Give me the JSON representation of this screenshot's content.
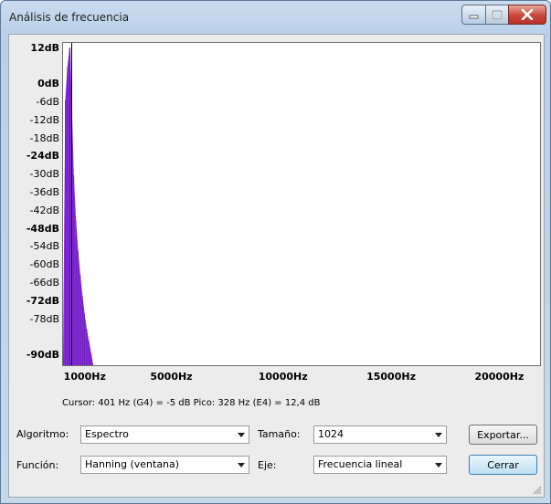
{
  "window": {
    "title": "Análisis de frecuencia"
  },
  "title_buttons": {
    "minimize": "minimize-icon",
    "maximize": "maximize-icon",
    "close": "close-icon"
  },
  "graph": {
    "y_ticks": [
      "12dB",
      "0dB",
      "-6dB",
      "-12dB",
      "-18dB",
      "-24dB",
      "-30dB",
      "-36dB",
      "-42dB",
      "-48dB",
      "-54dB",
      "-60dB",
      "-66dB",
      "-72dB",
      "-78dB",
      "-90dB"
    ],
    "x_ticks": [
      "1000Hz",
      "5000Hz",
      "10000Hz",
      "15000Hz",
      "20000Hz"
    ],
    "fill_color": "#8a2be2"
  },
  "chart_data": {
    "type": "area",
    "xlabel": "",
    "ylabel": "",
    "xlim": [
      0,
      22050
    ],
    "ylim": [
      -93,
      14
    ],
    "x_ticks": [
      1000,
      5000,
      10000,
      15000,
      20000
    ],
    "y_ticks": [
      12,
      0,
      -6,
      -12,
      -18,
      -24,
      -30,
      -36,
      -42,
      -48,
      -54,
      -60,
      -66,
      -72,
      -78,
      -90
    ],
    "x": [
      0,
      100,
      200,
      300,
      328,
      401,
      500,
      600,
      700,
      800,
      900,
      1000,
      1100,
      1200,
      1300,
      1400
    ],
    "values": [
      -90,
      -5,
      6,
      12.4,
      12.4,
      -5,
      -30,
      -45,
      -55,
      -63,
      -70,
      -76,
      -81,
      -85,
      -89,
      -93
    ],
    "color": "#8a2be2",
    "grid": false
  },
  "status": {
    "text": "Cursor: 401 Hz (G4) = -5 dB   Pico: 328 Hz (E4) = 12,4 dB"
  },
  "controls": {
    "algoritmo_label": "Algoritmo:",
    "algoritmo_value": "Espectro",
    "funcion_label": "Función:",
    "funcion_value": "Hanning (ventana)",
    "tamano_label": "Tamaño:",
    "tamano_value": "1024",
    "eje_label": "Eje:",
    "eje_value": "Frecuencia lineal",
    "exportar_label": "Exportar...",
    "cerrar_label": "Cerrar"
  }
}
